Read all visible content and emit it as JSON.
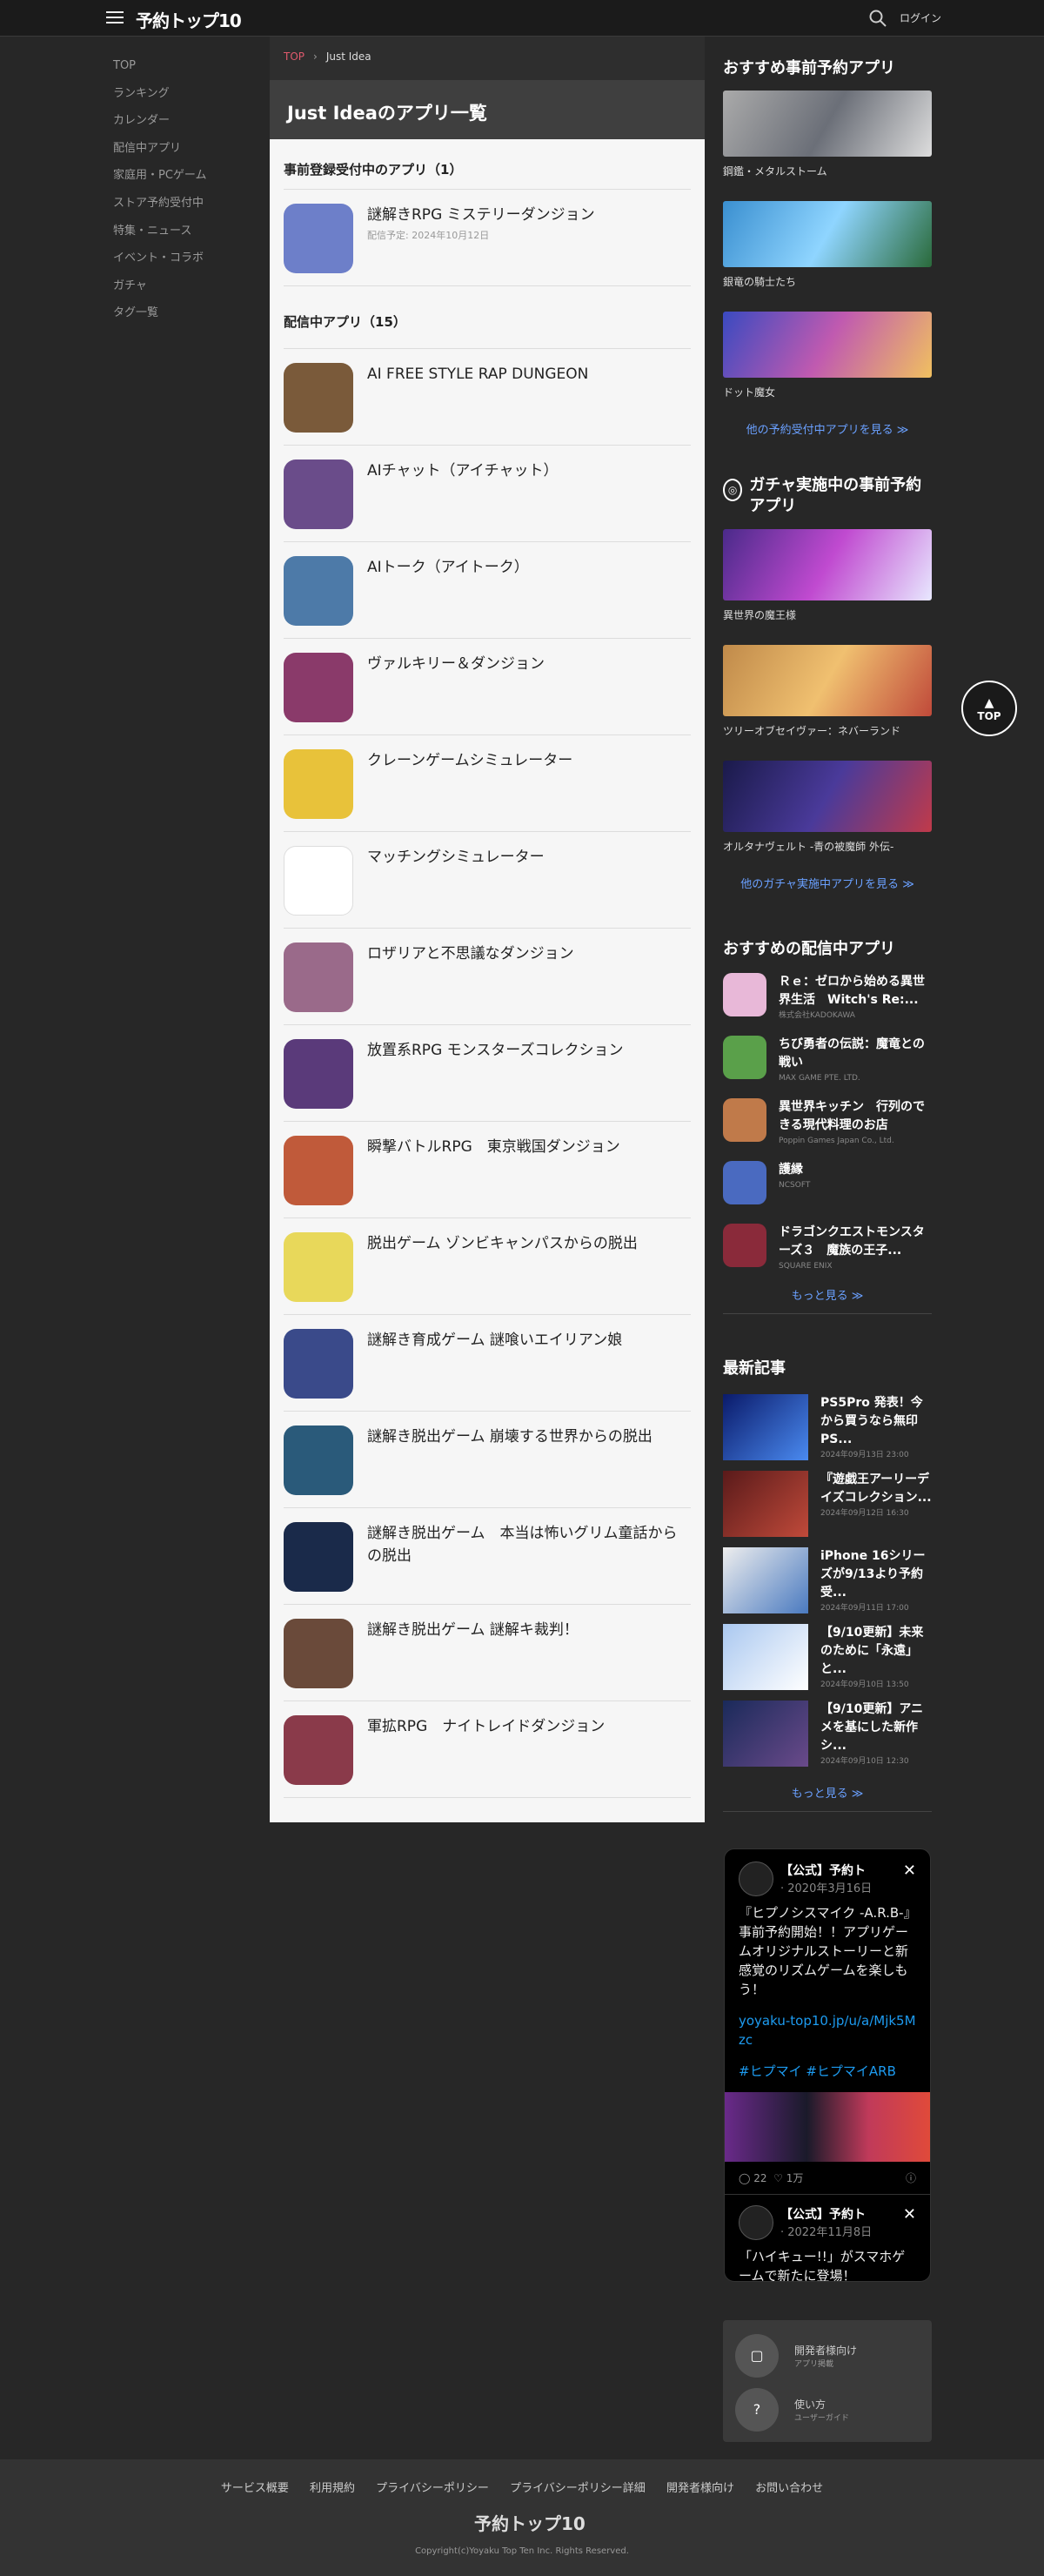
{
  "header": {
    "logo": "予約トップ10",
    "login": "ログイン"
  },
  "nav": [
    "TOP",
    "ランキング",
    "カレンダー",
    "配信中アプリ",
    "家庭用・PCゲーム",
    "ストア予約受付中",
    "特集・ニュース",
    "イベント・コラボ",
    "ガチャ",
    "タグ一覧"
  ],
  "breadcrumb": {
    "top": "TOP",
    "current": "Just Idea"
  },
  "page_title": "Just Ideaのアプリ一覧",
  "preorder_heading": "事前登録受付中のアプリ（1）",
  "preorder_apps": [
    {
      "name": "謎解きRPG ミステリーダンジョン",
      "date": "配信予定: 2024年10月12日"
    }
  ],
  "released_heading": "配信中アプリ（15）",
  "released_apps": [
    {
      "name": "AI FREE STYLE RAP DUNGEON"
    },
    {
      "name": "AIチャット（アイチャット）"
    },
    {
      "name": "AIトーク（アイトーク）"
    },
    {
      "name": "ヴァルキリー＆ダンジョン"
    },
    {
      "name": "クレーンゲームシミュレーター"
    },
    {
      "name": "マッチングシミュレーター"
    },
    {
      "name": "ロザリアと不思議なダンジョン"
    },
    {
      "name": "放置系RPG モンスターズコレクション"
    },
    {
      "name": "瞬撃バトルRPG　東京戦国ダンジョン"
    },
    {
      "name": "脱出ゲーム ゾンビキャンパスからの脱出"
    },
    {
      "name": "謎解き育成ゲーム 謎喰いエイリアン娘"
    },
    {
      "name": "謎解き脱出ゲーム 崩壊する世界からの脱出"
    },
    {
      "name": "謎解き脱出ゲーム　本当は怖いグリム童話からの脱出"
    },
    {
      "name": "謎解き脱出ゲーム 謎解キ裁判！"
    },
    {
      "name": "軍拡RPG　ナイトレイドダンジョン"
    }
  ],
  "icon_colors": [
    "#6d7fc9",
    "#7a5a3a",
    "#6a4c8a",
    "#4d7aa8",
    "#8a3a6a",
    "#e8c23a",
    "#ffffff",
    "#9a6a8a",
    "#5a3a7a",
    "#c05a3a",
    "#e8d85a",
    "#3a4a8a",
    "#2a5a7a",
    "#1a2a4a",
    "#6a4a3a",
    "#8a3a4a"
  ],
  "sidebar": {
    "recommended_preorder": {
      "title": "おすすめ事前予約アプリ",
      "items": [
        "鋼鑑・メタルストーム",
        "銀竜の騎士たち",
        "ドット魔女"
      ],
      "more": "他の予約受付中アプリを見る ≫"
    },
    "gacha": {
      "title": "ガチャ実施中の事前予約アプリ",
      "items": [
        "異世界の魔王様",
        "ツリーオブセイヴァー：ネバーランド",
        "オルタナヴェルト -青の被魔師 外伝-"
      ],
      "more": "他のガチャ実施中アプリを見る ≫"
    },
    "recommended_released": {
      "title": "おすすめの配信中アプリ",
      "items": [
        {
          "name": "Ｒｅ：ゼロから始める異世界生活　Witch's Re:...",
          "company": "株式会社KADOKAWA"
        },
        {
          "name": "ちび勇者の伝説：魔竜との戦い",
          "company": "MAX GAME PTE. LTD."
        },
        {
          "name": "異世界キッチン　行列のできる現代料理のお店",
          "company": "Poppin Games Japan Co., Ltd."
        },
        {
          "name": "護縁",
          "company": "NCSOFT"
        },
        {
          "name": "ドラゴンクエストモンスターズ３　魔族の王子...",
          "company": "SQUARE ENIX"
        }
      ],
      "more": "もっと見る ≫"
    },
    "news": {
      "title": "最新記事",
      "items": [
        {
          "title": "PS5Pro 発表！今から買うなら無印PS...",
          "date": "2024年09月13日 23:00"
        },
        {
          "title": "『遊戯王アーリーデイズコレクション...",
          "date": "2024年09月12日 16:30"
        },
        {
          "title": "iPhone 16シリーズが9/13より予約受...",
          "date": "2024年09月11日 17:00"
        },
        {
          "title": "【9/10更新】未来のために「永遠」と...",
          "date": "2024年09月10日 13:50"
        },
        {
          "title": "【9/10更新】アニメを基にした新作シ...",
          "date": "2024年09月10日 12:30"
        }
      ],
      "more": "もっと見る ≫"
    }
  },
  "tweets": [
    {
      "name": "【公式】予約ト",
      "date": "· 2020年3月16日",
      "text": "『ヒプノシスマイク -A.R.B-』事前予約開始！！アプリゲームオリジナルストーリーと新感覚のリズムゲームを楽しもう！",
      "link": "yoyaku-top10.jp/u/a/Mjk5Mzc",
      "tags": "#ヒプマイ #ヒプマイARB",
      "replies": "22",
      "likes": "1万"
    },
    {
      "name": "【公式】予約ト",
      "date": "· 2022年11月8日",
      "text": "「ハイキュー!!」がスマホゲームで新たに登場！"
    }
  ],
  "dev_links": [
    {
      "label": "開発者様向け",
      "sub": "アプリ掲載"
    },
    {
      "label": "使い方",
      "sub": "ユーザーガイド"
    }
  ],
  "footer": {
    "links": [
      "サービス概要",
      "利用規約",
      "プライバシーポリシー",
      "プライバシーポリシー詳細",
      "開発者様向け",
      "お問い合わせ"
    ],
    "copyright": "Copyright(c)Yoyaku Top Ten Inc. Rights Reserved."
  },
  "to_top": "TOP"
}
